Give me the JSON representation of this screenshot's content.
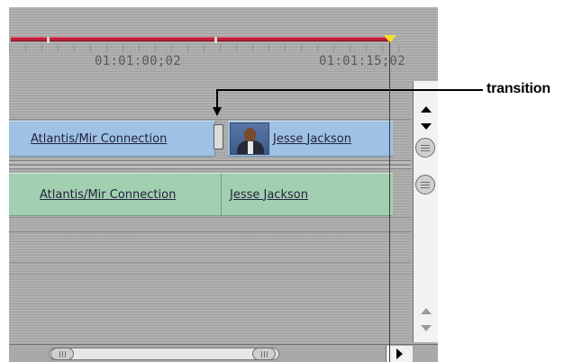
{
  "ruler": {
    "timecode_left": "01:01:00;02",
    "timecode_right": "01:01:15;02"
  },
  "video_track": {
    "clips": [
      {
        "label": "Atlantis/Mir Connection"
      },
      {
        "label": "Jesse Jackson"
      }
    ]
  },
  "audio_track": {
    "clips": [
      {
        "label": "Atlantis/Mir Connection"
      },
      {
        "label": "Jesse Jackson"
      }
    ]
  },
  "callout": {
    "label": "transition"
  },
  "colors": {
    "video_clip": "#9ec1e4",
    "audio_clip": "#a2cfb0",
    "render_bar": "#c21d3c",
    "playhead_marker": "#f2e02a"
  },
  "icons": [
    "scroll-up-arrow-icon",
    "scroll-down-arrow-icon",
    "scroll-right-arrow-icon",
    "clip-thumbnail-icon"
  ]
}
